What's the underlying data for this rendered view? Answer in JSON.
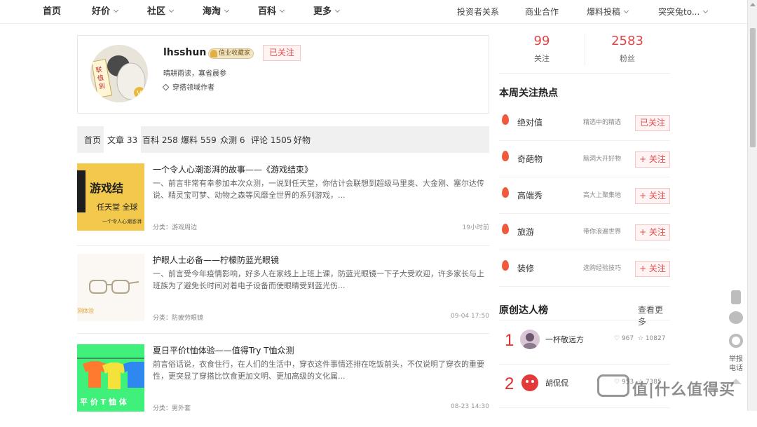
{
  "nav": {
    "left": [
      "首页",
      "好价",
      "社区",
      "海淘",
      "百科",
      "更多"
    ],
    "right": [
      "投资者关系",
      "商业合作",
      "爆料投稿",
      "突突兔to..."
    ]
  },
  "profile": {
    "username": "lhsshun",
    "badge": "值业收藏家",
    "follow_status": "已关注",
    "motto": "晴耕雨读，寡省晨参",
    "domain": "穿搭领域作者",
    "avatar_text": "就值了"
  },
  "tabs": [
    "首页",
    "文章 33",
    "百科 258",
    "爆料 559",
    "众测 6",
    "评论 1505",
    "好物"
  ],
  "articles": [
    {
      "title": "一个令人心潮澎湃的故事——《游戏结束》",
      "excerpt": "一、前言非常有幸参加本次众测，一说到任天堂，你估计会联想到超级马里奥、大金刚、塞尔达传说、精灵宝可梦、动物之森等风靡全世界的系列游戏，...",
      "category": "分类：游戏周边",
      "time": "19小时前",
      "thumb_title": "游戏结",
      "thumb_sub": "任天堂  全球",
      "thumb_cap": "一个令人心潮澎湃"
    },
    {
      "title": "护眼人士必备——柠檬防蓝光眼镜",
      "excerpt": "一、前言受今年疫情影响，好多人在家线上上班上课，防蓝光眼镜一下子大受欢迎，许多家长与上班族为了避免长时间对着电子设备而使眼睛受到蓝光伤...",
      "category": "分类：防疲劳眼镜",
      "time": "09-04 17:50",
      "thumb_cap": "测体验"
    },
    {
      "title": "夏日平价t恤体验——值得Try T恤众测",
      "excerpt": "前言俗话说，衣食住行，在人们的生活中，穿衣这件事情还排在吃饭前头，不仅说明了穿衣的重要性，更突显了穿搭比饮食更加文明、更加高级的文化属...",
      "category": "分类：男外套",
      "time": "08-23 14:30",
      "thumb_cap": "平 价 T 恤 体"
    }
  ],
  "stats": {
    "following": "99",
    "following_label": "关注",
    "fans": "2583",
    "fans_label": "粉丝"
  },
  "hot": {
    "title": "本周关注热点",
    "items": [
      {
        "name": "绝对值",
        "desc": "精选中的精选",
        "btn": "已关注"
      },
      {
        "name": "奇葩物",
        "desc": "脑洞大开好物",
        "btn": "+ 关注"
      },
      {
        "name": "高端秀",
        "desc": "高大上聚集地",
        "btn": "+ 关注"
      },
      {
        "name": "旅游",
        "desc": "带你浪遍世界",
        "btn": "+ 关注"
      },
      {
        "name": "装修",
        "desc": "选购经验技巧",
        "btn": "+ 关注"
      }
    ]
  },
  "ranking": {
    "title": "原创达人榜",
    "more": "查看更多",
    "items": [
      {
        "rank": "1",
        "name": "一杯敬远方",
        "likes": "967",
        "stars": "10827"
      },
      {
        "rank": "2",
        "name": "胡侃侃",
        "likes": "953",
        "stars": "7385"
      }
    ]
  },
  "side": {
    "report": "举报",
    "report2": "电话"
  },
  "watermark": "值|什么值得买",
  "colors": {
    "accent": "#e24545",
    "follow_bg": "#fff3f3"
  }
}
